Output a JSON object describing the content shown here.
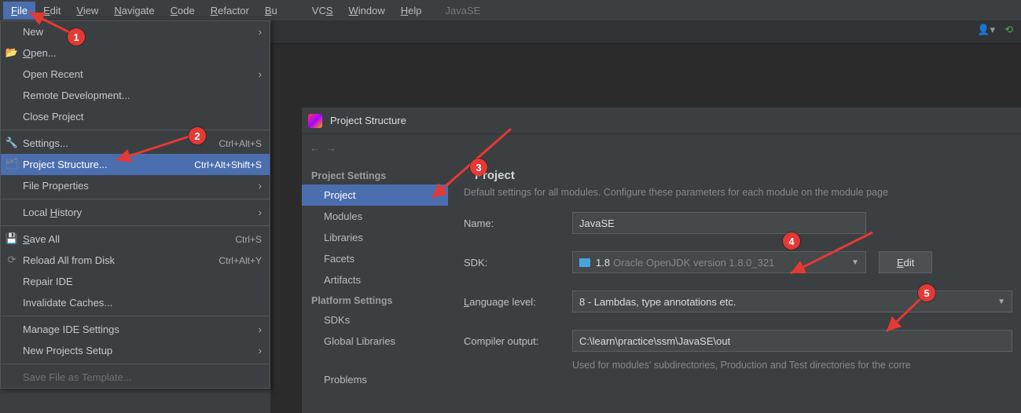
{
  "menubar": {
    "items": [
      {
        "label": "File",
        "mn": "F",
        "active": true
      },
      {
        "label": "Edit",
        "mn": "E"
      },
      {
        "label": "View",
        "mn": "V"
      },
      {
        "label": "Navigate",
        "mn": "N"
      },
      {
        "label": "Code",
        "mn": "C"
      },
      {
        "label": "Refactor",
        "mn": "R"
      },
      {
        "label": "B",
        "mn": "B",
        "trunc": true
      }
    ],
    "items2": [
      {
        "label": "VCS",
        "mn": "S"
      },
      {
        "label": "Window",
        "mn": "W"
      },
      {
        "label": "Help",
        "mn": "H"
      }
    ],
    "project_label": "JavaSE"
  },
  "file_menu": {
    "new": "New",
    "open": "Open...",
    "open_recent": "Open Recent",
    "remote_dev": "Remote Development...",
    "close_project": "Close Project",
    "settings": "Settings...",
    "settings_sc": "Ctrl+Alt+S",
    "proj_struct": "Project Structure...",
    "proj_struct_sc": "Ctrl+Alt+Shift+S",
    "file_props": "File Properties",
    "local_hist": "Local History",
    "save_all": "Save All",
    "save_all_sc": "Ctrl+S",
    "reload": "Reload All from Disk",
    "reload_sc": "Ctrl+Alt+Y",
    "repair": "Repair IDE",
    "invalidate": "Invalidate Caches...",
    "manage_ide": "Manage IDE Settings",
    "new_proj_setup": "New Projects Setup",
    "save_tpl": "Save File as Template..."
  },
  "ps": {
    "title": "Project Structure",
    "side": {
      "cat1": "Project Settings",
      "project": "Project",
      "modules": "Modules",
      "libraries": "Libraries",
      "facets": "Facets",
      "artifacts": "Artifacts",
      "cat2": "Platform Settings",
      "sdks": "SDKs",
      "glibs": "Global Libraries",
      "problems": "Problems"
    },
    "content": {
      "heading": "Project",
      "hint": "Default settings for all modules. Configure these parameters for each module on the module page",
      "name_lbl": "Name:",
      "name_val": "JavaSE",
      "sdk_lbl": "SDK:",
      "sdk_ver": "1.8",
      "sdk_desc": "Oracle OpenJDK version 1.8.0_321",
      "edit_btn": "Edit",
      "lang_lbl": "Language level:",
      "lang_val": "8 - Lambdas, type annotations etc.",
      "out_lbl": "Compiler output:",
      "out_val": "C:\\learn\\practice\\ssm\\JavaSE\\out",
      "out_hint": "Used for modules' subdirectories, Production and Test directories for the corre"
    }
  },
  "callouts": {
    "1": "1",
    "2": "2",
    "3": "3",
    "4": "4",
    "5": "5"
  }
}
